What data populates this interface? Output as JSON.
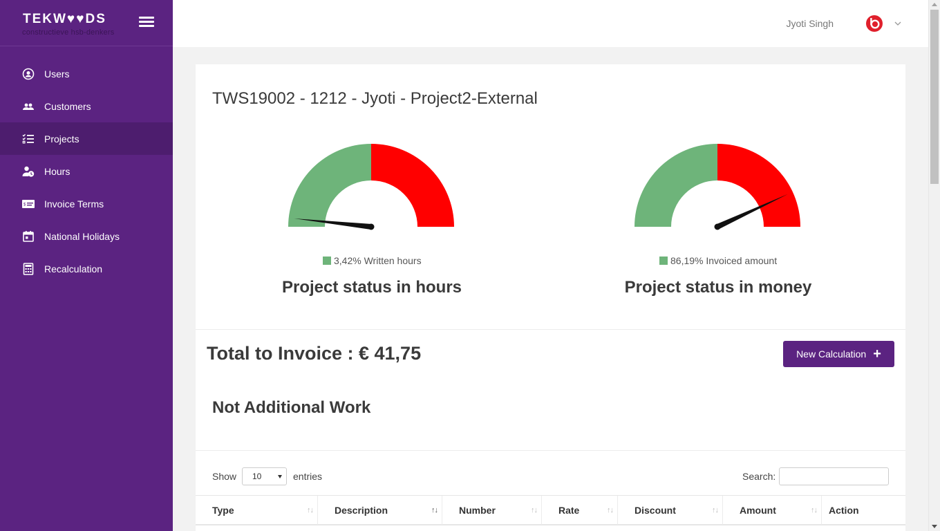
{
  "sidebar": {
    "logo": "TEKW♥♥DS",
    "logo_sub": "constructieve hsb-denkers",
    "items": [
      {
        "label": "Users",
        "icon": "user-circle-icon"
      },
      {
        "label": "Customers",
        "icon": "users-icon"
      },
      {
        "label": "Projects",
        "icon": "tasks-list-icon",
        "active": true
      },
      {
        "label": "Hours",
        "icon": "user-clock-icon"
      },
      {
        "label": "Invoice Terms",
        "icon": "invoice-card-icon"
      },
      {
        "label": "National Holidays",
        "icon": "calendar-icon"
      },
      {
        "label": "Recalculation",
        "icon": "calculator-icon"
      }
    ]
  },
  "topbar": {
    "user_name": "Jyoti Singh",
    "avatar_icon": "beats-logo-icon",
    "avatar_color": "#e0202c"
  },
  "project": {
    "title": "TWS19002 - 1212 - Jyoti - Project2-External"
  },
  "gauges": [
    {
      "legend": "3,42% Written hours",
      "value": 3.42,
      "title": "Project status in hours"
    },
    {
      "legend": "86,19% Invoiced amount",
      "value": 86.19,
      "title": "Project status in money"
    }
  ],
  "colors": {
    "primary": "#5b2381",
    "gauge_green": "#6eb47a",
    "gauge_red": "#ff0000"
  },
  "invoice": {
    "total": "Total to Invoice : € 41,75",
    "new_button": "New Calculation",
    "section_title": "Not Additional Work"
  },
  "table": {
    "show_label": "Show",
    "entries_value": "10",
    "entries_label": "entries",
    "search_label": "Search:",
    "columns": [
      "Type",
      "Description",
      "Number",
      "Rate",
      "Discount",
      "Amount",
      "Action"
    ]
  }
}
